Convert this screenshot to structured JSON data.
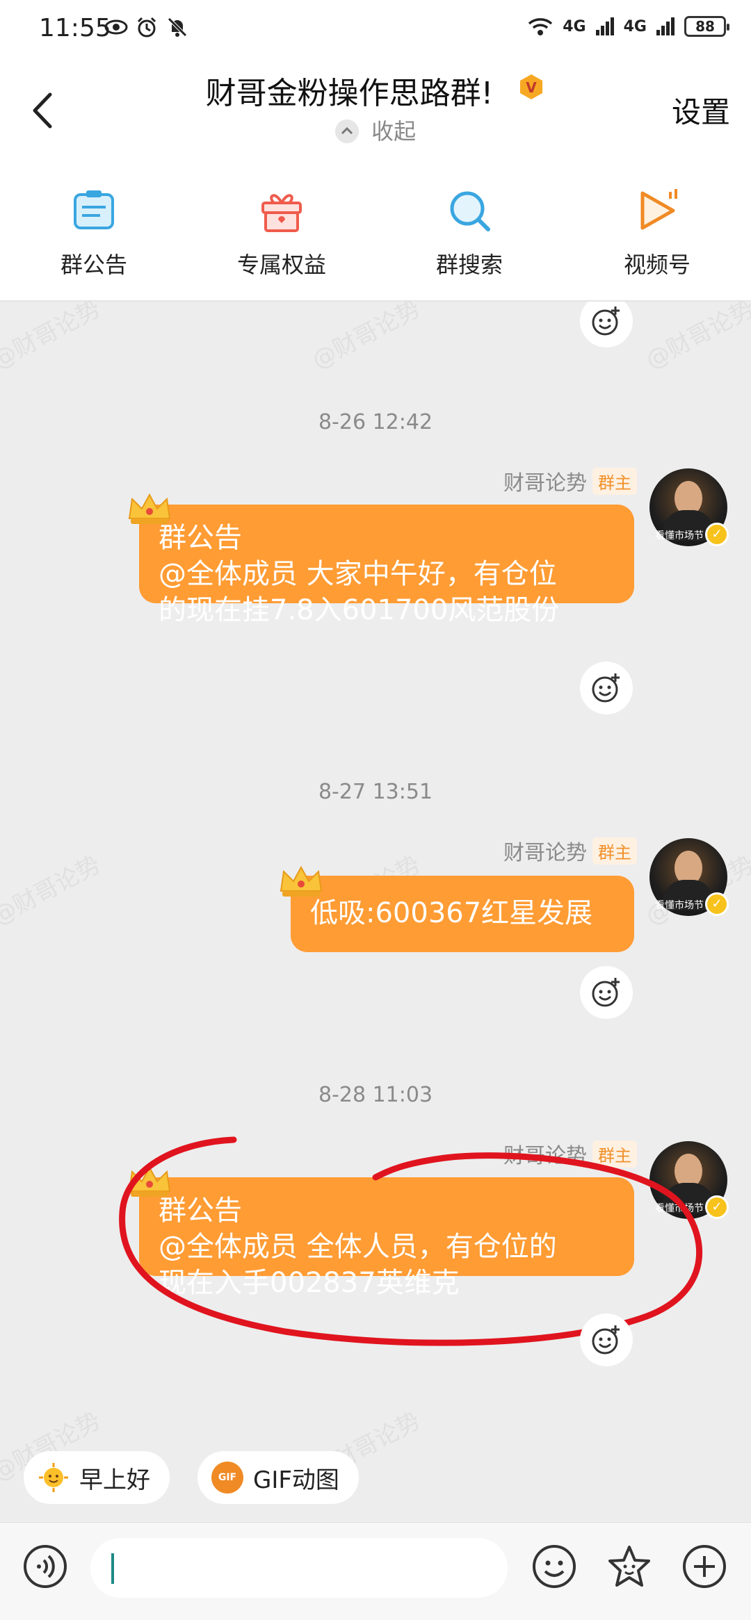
{
  "status_bar": {
    "time": "11:55",
    "signal1": "4G",
    "signal2": "4G",
    "battery": "88"
  },
  "header": {
    "title": "财哥金粉操作思路群!",
    "collapse_label": "收起",
    "settings_label": "设置",
    "badge_letter": "V"
  },
  "toolbar": {
    "items": [
      {
        "label": "群公告",
        "icon": "announcement-icon"
      },
      {
        "label": "专属权益",
        "icon": "gift-icon"
      },
      {
        "label": "群搜索",
        "icon": "search-icon"
      },
      {
        "label": "视频号",
        "icon": "video-channel-icon"
      }
    ]
  },
  "messages": [
    {
      "timestamp": "8-26 12:42",
      "sender": "财哥论势",
      "role": "群主",
      "line1": "群公告",
      "line2": "@全体成员 大家中午好，有仓位",
      "line3": "的现在挂7.8入601700风范股份"
    },
    {
      "timestamp": "8-27 13:51",
      "sender": "财哥论势",
      "role": "群主",
      "line1": "低吸:600367红星发展"
    },
    {
      "timestamp": "8-28 11:03",
      "sender": "财哥论势",
      "role": "群主",
      "line1": "群公告",
      "line2": "@全体成员 全体人员，有仓位的",
      "line3": "现在入手002837英维克"
    }
  ],
  "avatar_caption": "看懂市场节",
  "watermark": "@财哥论势",
  "quick_replies": [
    {
      "label": "早上好",
      "icon": "sun-emoji-icon"
    },
    {
      "label": "GIF动图",
      "icon": "gif-icon",
      "icon_text": "GIF"
    }
  ],
  "colors": {
    "bubble": "#ff9c34",
    "annotation_circle": "#e0141e",
    "owner_badge": "#f0902a"
  }
}
